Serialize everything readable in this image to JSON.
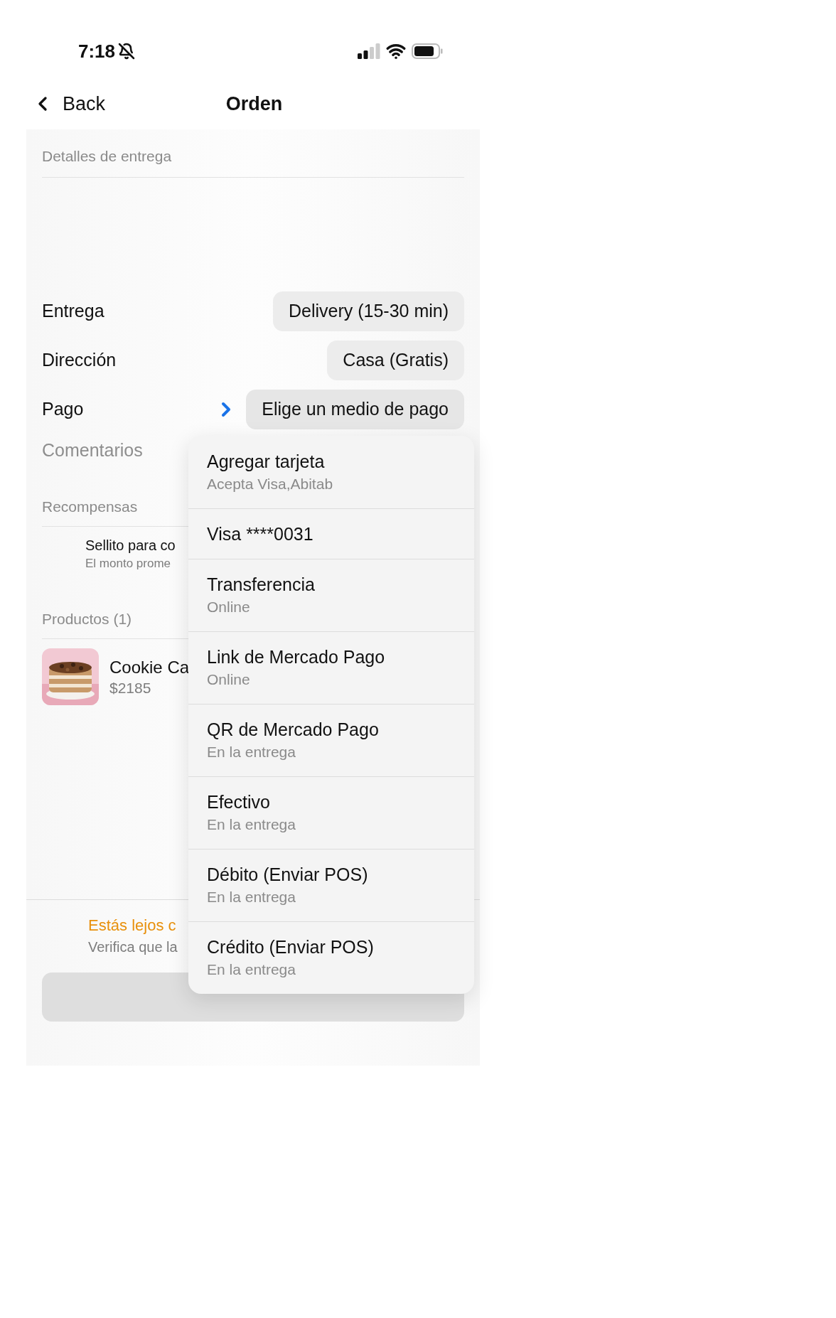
{
  "status_bar": {
    "time": "7:18"
  },
  "nav": {
    "back": "Back",
    "title": "Orden"
  },
  "delivery_header": "Detalles de entrega",
  "fields": [
    {
      "label": "Entrega",
      "value": "Delivery (15-30 min)",
      "kind": "select"
    },
    {
      "label": "Dirección",
      "value": "Casa (Gratis)",
      "kind": "select"
    },
    {
      "label": "Pago",
      "value": "Elige un medio de pago",
      "kind": "menu"
    }
  ],
  "comments": {
    "placeholder": "Comentarios"
  },
  "rewards": {
    "header": "Recompensas",
    "items": [
      {
        "title": "Sellito para co",
        "subtitle": "El monto prome"
      }
    ]
  },
  "products": {
    "header": "Productos (1)",
    "items": [
      {
        "name": "Cookie Ca",
        "price": "$2185"
      }
    ]
  },
  "warning": {
    "title": "Estás lejos c",
    "subtitle": "Verifica que la"
  },
  "buy_button": {
    "disabled": true
  },
  "payment_menu": [
    {
      "title": "Agregar tarjeta",
      "subtitle": "Acepta Visa,Abitab"
    },
    {
      "title": "Visa ****0031"
    },
    {
      "title": "Transferencia",
      "subtitle": "Online"
    },
    {
      "title": "Link de Mercado Pago",
      "subtitle": "Online"
    },
    {
      "title": "QR de Mercado Pago",
      "subtitle": "En la entrega"
    },
    {
      "title": "Efectivo",
      "subtitle": "En la entrega"
    },
    {
      "title": "Débito (Enviar POS)",
      "subtitle": "En la entrega"
    },
    {
      "title": "Crédito (Enviar POS)",
      "subtitle": "En la entrega"
    }
  ]
}
